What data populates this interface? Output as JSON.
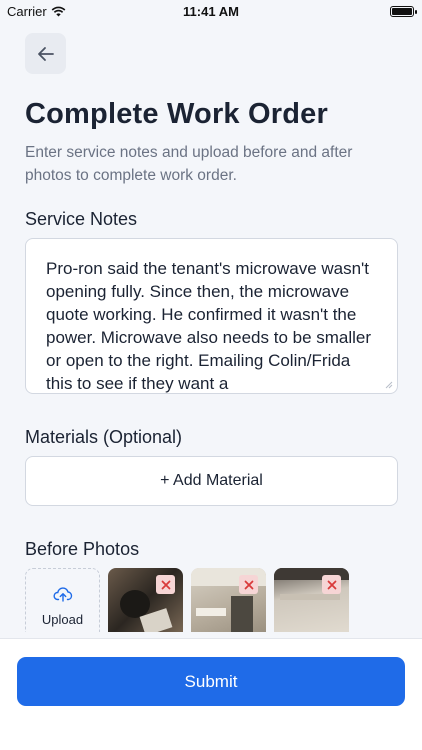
{
  "status_bar": {
    "carrier": "Carrier",
    "time": "11:41 AM"
  },
  "header": {
    "back_icon": "arrow-left-icon",
    "title": "Complete Work Order",
    "subtitle": "Enter service notes and upload before and after photos to complete work order."
  },
  "service_notes": {
    "label": "Service Notes",
    "value": "Pro-ron said the tenant's microwave wasn't opening fully. Since then, the microwave quote working. He confirmed it wasn't the power. Microwave also needs to be smaller or open to the right. Emailing Colin/Frida this to see if they want a"
  },
  "materials": {
    "label": "Materials (Optional)",
    "add_label": "+ Add Material"
  },
  "before_photos": {
    "label": "Before Photos",
    "upload_label": "Upload",
    "upload_icon": "cloud-upload-icon",
    "remove_icon": "close-icon",
    "count": 3
  },
  "footer": {
    "submit_label": "Submit"
  },
  "colors": {
    "accent": "#1f6be8",
    "remove_bg": "#f6d5d5",
    "remove_x": "#d93a3a"
  }
}
